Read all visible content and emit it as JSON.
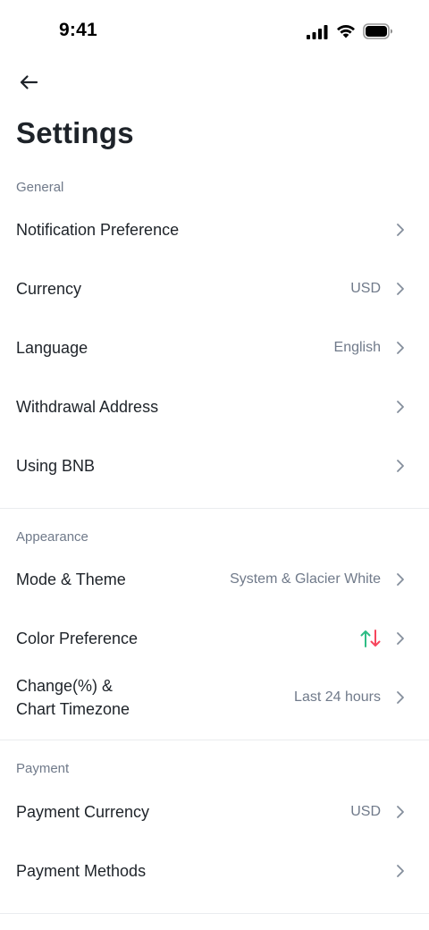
{
  "status_bar": {
    "time": "9:41",
    "icons": [
      "cellular-signal-icon",
      "wifi-icon",
      "battery-icon"
    ]
  },
  "nav": {
    "back_icon": "arrow-left-icon",
    "title": "Settings"
  },
  "sections": {
    "general": {
      "header": "General",
      "items": [
        {
          "label": "Notification Preference",
          "value": ""
        },
        {
          "label": "Currency",
          "value": "USD"
        },
        {
          "label": "Language",
          "value": "English"
        },
        {
          "label": "Withdrawal Address",
          "value": ""
        },
        {
          "label": "Using BNB",
          "value": ""
        }
      ]
    },
    "appearance": {
      "header": "Appearance",
      "items": [
        {
          "label": "Mode & Theme",
          "value": "System & Glacier White"
        },
        {
          "label": "Color Preference",
          "value": "",
          "icon": "up-down-arrows-icon"
        },
        {
          "label_line1": "Change(%) &",
          "label_line2": "Chart Timezone",
          "value": "Last 24 hours"
        }
      ]
    },
    "payment": {
      "header": "Payment",
      "items": [
        {
          "label": "Payment Currency",
          "value": "USD"
        },
        {
          "label": "Payment Methods",
          "value": ""
        }
      ]
    }
  },
  "colors": {
    "text_primary": "#1e2329",
    "text_secondary": "#707a8a",
    "divider": "#eaecef",
    "up_green": "#2ebd85",
    "down_red": "#f6465d",
    "chevron": "#848e9c"
  }
}
